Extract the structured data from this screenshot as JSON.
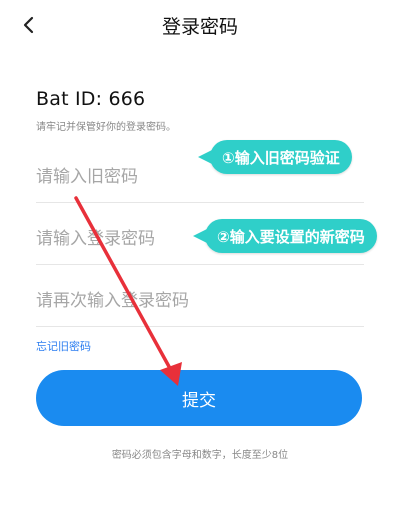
{
  "header": {
    "title": "登录密码",
    "back_icon": "chevron-left-icon"
  },
  "account": {
    "id_text": "Bat ID: 666",
    "hint": "请牢记并保管好你的登录密码。"
  },
  "form": {
    "old_password_placeholder": "请输入旧密码",
    "new_password_placeholder": "请输入登录密码",
    "confirm_password_placeholder": "请再次输入登录密码",
    "forgot_link": "忘记旧密码",
    "submit_label": "提交",
    "requirement_note": "密码必须包含字母和数字，长度至少8位"
  },
  "annotations": {
    "callout_1": "①输入旧密码验证",
    "callout_2": "②输入要设置的新密码",
    "callout_color": "#2fcfc9",
    "arrow_color": "#e8303a"
  },
  "colors": {
    "accent": "#1a8bf0",
    "link": "#2b7df0"
  }
}
